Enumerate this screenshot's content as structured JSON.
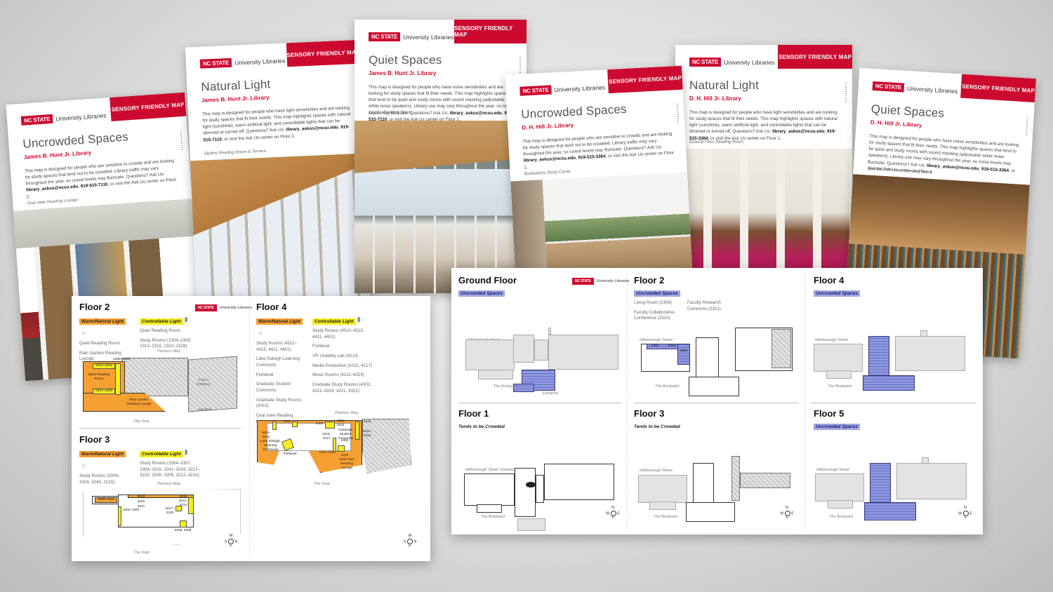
{
  "brand": {
    "mark": "NC STATE",
    "name": "University Libraries",
    "band_label": "SENSORY FRIENDLY MAP",
    "accent_color": "#cc0a2f"
  },
  "covers": [
    {
      "title": "Uncrowded Spaces",
      "library": "James B. Hunt Jr. Library",
      "desc_pre": "This map is designed for people who are sensitive to crowds and are looking for study spaces that tend not to be crowded. Library traffic may vary throughout the year, so crowd levels may fluctuate. Questions? Ask Us: ",
      "email": "library_askus@ncsu.edu",
      "phone": "919-515-7110",
      "desc_post": ", or visit the Ask Us center on Floor 2.",
      "caption": "Oval View Reading Lounge"
    },
    {
      "title": "Natural Light",
      "library": "James B. Hunt Jr. Library",
      "desc_pre": "This map is designed for people who have light sensitivities and are looking for study spaces that fit their needs. This map highlights spaces with natural light (sunshine), warm artificial light, and controllable lights that can be dimmed or turned off. Questions? Ask Us: ",
      "email": "library_askus@ncsu.edu",
      "phone": "919-515-7110",
      "desc_post": ", or visit the Ask Us center on Floor 2.",
      "caption": "Skyline Reading Room & Terrace"
    },
    {
      "title": "Quiet Spaces",
      "library": "James B. Hunt Jr. Library",
      "desc_pre": "This map is designed for people who have noise sensitivities and are looking for study spaces that fit their needs. This map highlights spaces that tend to be quiet and study rooms with sound masking (adjustable white noise speakers). Library use may vary throughout the year, so noise levels may fluctuate. Questions? Ask Us: ",
      "email": "library_askus@ncsu.edu",
      "phone": "919-515-7110",
      "desc_post": ", or visit the Ask Us center on Floor 2.",
      "caption": "Skyline Reading Room"
    },
    {
      "title": "Uncrowded Spaces",
      "library": "D. H. Hill Jr. Library",
      "desc_pre": "This map is designed for people who are sensitive to crowds and are looking for study spaces that tend not to be crowded. Library traffic may vary throughout the year, so crowd levels may fluctuate. Questions? Ask Us: ",
      "email": "library_askus@ncsu.edu",
      "phone": "919-515-3364",
      "desc_post": ", or visit the Ask Us center on Floor 1.",
      "caption": "Bookstacks Study Carrel"
    },
    {
      "title": "Natural Light",
      "library": "D. H. Hill Jr. Library",
      "desc_pre": "This map is designed for people who have light sensitivities and are looking for study spaces that fit their needs. This map highlights spaces with natural light (sunshine), warm artificial light, and controllable lights that can be dimmed or turned off. Questions? Ask Us: ",
      "email": "library_askus@ncsu.edu",
      "phone": "919-515-3364",
      "desc_post": ", or visit the Ask Us center on Floor 1.",
      "caption": "Ground Floor Reading Room"
    },
    {
      "title": "Quiet Spaces",
      "library": "D. H. Hill Jr. Library",
      "desc_pre": "This map is designed for people who have noise sensitivities and are looking for study spaces that fit their needs. This map highlights spaces that tend to be quiet and study rooms with sound masking (adjustable white noise speakers). Library use may vary throughout the year, so noise levels may fluctuate. Questions? Ask Us: ",
      "email": "library_askus@ncsu.edu",
      "phone": "919-515-3364",
      "desc_post": ", or visit the Ask Us center on Floor 1.",
      "caption": "Special Collections Reading Room"
    }
  ],
  "hunt_map": {
    "legend": {
      "warm": "Warm/Natural Light",
      "controllable": "Controllable Light"
    },
    "floor2": {
      "title": "Floor 2",
      "warm_items": [
        "Quiet Reading Room",
        "Rain Garden Reading Lounge"
      ],
      "ctrl_items": [
        "Quiet Reading Room",
        "Study Rooms (2304–2309, 2312–2315, 2322–2328)"
      ],
      "labels": {
        "street_top": "Partners Way",
        "street_bottom": "The Oval",
        "room_a": "2306–2309",
        "room_b": "2312–2316",
        "room_c": "2322–2328",
        "quiet": "Quiet Reading Room",
        "rain": "Rain Garden Reading Lounge",
        "entrance1": "Floor 1 Entrance",
        "entrance2": "Entrance"
      }
    },
    "floor3": {
      "title": "Floor 3",
      "warm_items": [
        "Study Rooms (3309–3316, 3243, 3215)"
      ],
      "ctrl_items": [
        "Study Rooms (3304–3307, 3309–3316, 3241–3243, 3217–3220, 3208, 3209, 3212–3215)"
      ],
      "labels": {
        "street_top": "Partners Way",
        "street_bottom": "The Oval",
        "r1": "3309–3316",
        "r2": "3243",
        "r3": "3242",
        "r4": "3241",
        "r5": "3304–3307",
        "r6": "3215",
        "r7": "3212–",
        "r8": "3214",
        "r9": "3217–3220",
        "r10": "3208",
        "r11": "3209"
      }
    },
    "floor4": {
      "title": "Floor 4",
      "warm_items": [
        "Study Rooms (4512–4515, 4411, 4401)",
        "Lake Raleigh Learning Commons",
        "Fishbowl",
        "Graduate Student Commons",
        "Graduate Study Rooms (4315)",
        "Oval View Reading Lounge"
      ],
      "ctrl_items": [
        "Study Rooms (4510–4515, 4411, 4401)",
        "Fishbowl",
        "VR Usability Lab (4210)",
        "Media Production (4215, 4217)",
        "Music Rooms (4211–4214)",
        "Graduate Study Rooms (4302, 4311–4314, 4321, 4322)"
      ],
      "labels": {
        "street_top": "Partners Way",
        "street_bottom": "The Oval",
        "lake": "Lake Raleigh Learning Commons",
        "fishbowl": "Fishbowl",
        "grad": "Graduate Student Commons",
        "oval": "Oval View Reading Lounge",
        "r4411": "4411",
        "r4401": "4401",
        "r4321": "4321",
        "r4322": "4322",
        "r4215": "4215, 4217",
        "r4302": "4302",
        "r4211": "4211–4214",
        "r4210": "4210",
        "r4510": "4510–4515",
        "r4315": "4315",
        "r4311": "4311–4314"
      }
    },
    "compass": {
      "n": "N",
      "s": "S",
      "e": "E",
      "w": "W"
    }
  },
  "hill_map": {
    "legend": {
      "uncrowded": "Uncrowded Spaces",
      "crowded": "Tends to be Crowded"
    },
    "streets": {
      "top": "Hillsborough Street",
      "bottom": "The Brickyard",
      "entrance": "Entrance"
    },
    "ground": {
      "title": "Ground Floor",
      "tag": "Uncrowded Spaces"
    },
    "floor1": {
      "title": "Floor 1",
      "tag": "Tends to be Crowded"
    },
    "floor2": {
      "title": "Floor 2",
      "tag": "Uncrowded Spaces",
      "items": [
        "Living Room (2306)",
        "Faculty Collaborative Conference (2310)",
        "Faculty Research Commons (2312)"
      ],
      "rooms": [
        "2306",
        "2310",
        "2312"
      ]
    },
    "floor3": {
      "title": "Floor 3",
      "tag": "Tends to be Crowded"
    },
    "floor4": {
      "title": "Floor 4",
      "tag": "Uncrowded Spaces"
    },
    "floor5": {
      "title": "Floor 5",
      "tag": "Uncrowded Spaces"
    },
    "compass": {
      "n": "N",
      "s": "S",
      "e": "E",
      "w": "W"
    }
  },
  "colors": {
    "warm_light": "#f5a031",
    "controllable_light": "#f6ee1a",
    "uncrowded": "#9ea6e8"
  }
}
